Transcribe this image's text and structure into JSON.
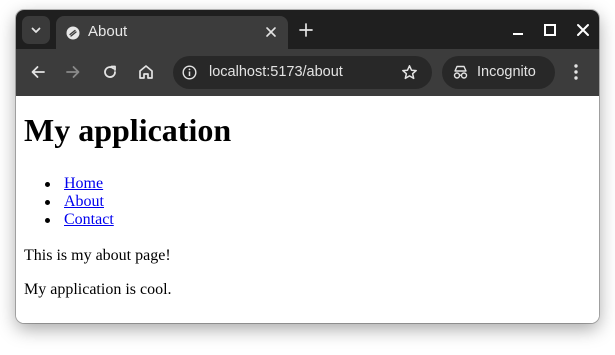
{
  "browser": {
    "tab": {
      "title": "About"
    },
    "address_bar": {
      "url": "localhost:5173/about"
    },
    "incognito_label": "Incognito"
  },
  "page": {
    "heading": "My application",
    "nav_links": [
      "Home",
      "About",
      "Contact"
    ],
    "paragraphs": [
      "This is my about page!",
      "My application is cool."
    ]
  },
  "icons": {
    "tab_search": "chevron-down-icon",
    "favicon": "favicon-icon",
    "tab_close": "close-icon",
    "new_tab": "plus-icon",
    "minimize": "minimize-icon",
    "maximize": "maximize-icon",
    "close_window": "close-icon",
    "back": "back-arrow-icon",
    "forward": "forward-arrow-icon",
    "reload": "reload-icon",
    "home": "home-icon",
    "site_info": "info-icon",
    "bookmark": "star-icon",
    "incognito": "incognito-icon",
    "menu": "more-vert-icon"
  },
  "colors": {
    "tabstrip": "#1f1f1f",
    "toolbar": "#3c3c3c",
    "omnibox": "#282828",
    "link": "#0000ee"
  }
}
